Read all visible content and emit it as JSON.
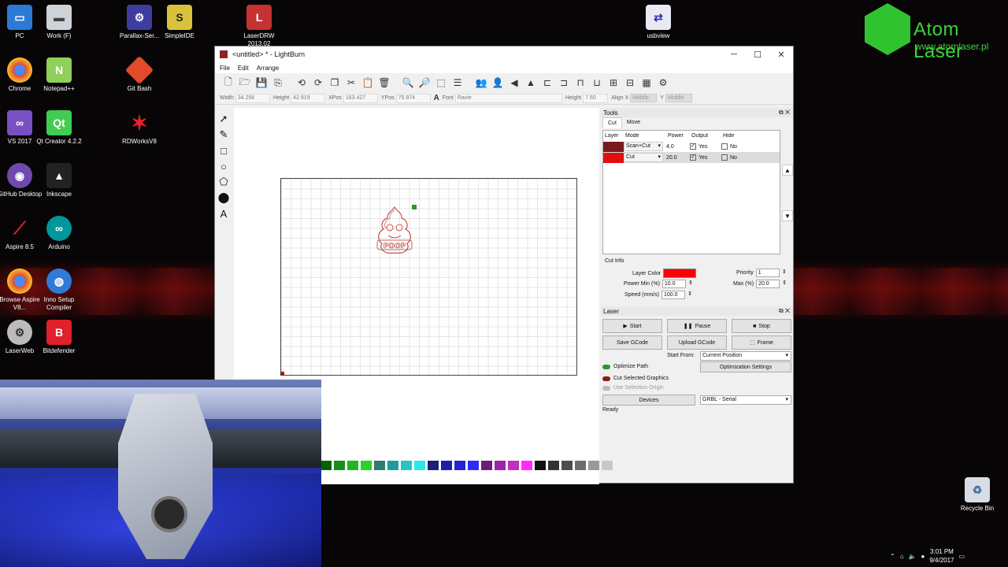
{
  "desktop": {
    "icons": [
      {
        "label": "PC"
      },
      {
        "label": "Work (F)"
      },
      {
        "label": "Parallax-Ser..."
      },
      {
        "label": "SimpleIDE"
      },
      {
        "label": "LaserDRW 2013.02"
      },
      {
        "label": "usbview"
      },
      {
        "label": "Chrome"
      },
      {
        "label": "Notepad++"
      },
      {
        "label": "Git Bash"
      },
      {
        "label": "VS 2017"
      },
      {
        "label": "Qt Creator 4.2.2"
      },
      {
        "label": "RDWorksV8"
      },
      {
        "label": "GitHub Desktop"
      },
      {
        "label": "Inkscape"
      },
      {
        "label": "Aspire 8.5"
      },
      {
        "label": "Arduino"
      },
      {
        "label": "Browse Aspire V8..."
      },
      {
        "label": "Inno Setup Compiler"
      },
      {
        "label": "LaserWeb"
      },
      {
        "label": "Bitdefender"
      },
      {
        "label": "Recycle Bin"
      }
    ],
    "logo": {
      "name": "Atom Laser",
      "url": "www.atomlaser.pl"
    },
    "tray": {
      "time": "3:01 PM",
      "date": "9/4/2017"
    }
  },
  "window": {
    "title": "<untitled> * - LightBurn",
    "menu": [
      "File",
      "Edit",
      "Arrange"
    ],
    "props": {
      "width_label": "Width",
      "width": "34.256",
      "height_label": "Height",
      "height": "42.919",
      "xpos_label": "XPos",
      "xpos": "163.427",
      "ypos_label": "YPos",
      "ypos": "75.974",
      "font_label": "Font",
      "font": "Ravie",
      "text_height_label": "Height",
      "text_height": "7.50",
      "alignx_label": "Align X",
      "alignx": "Middle",
      "aligny_label": "Y",
      "aligny": "Middle"
    },
    "canvas": {
      "drawing_text": "POOP"
    },
    "palette": [
      "#006400",
      "#1a8c1a",
      "#22b422",
      "#29d429",
      "#2e7d6e",
      "#1e9c9c",
      "#26c4c4",
      "#2ee8e8",
      "#1c1c7a",
      "#1e1eaa",
      "#2424d4",
      "#2a2aff",
      "#6e1e7a",
      "#9a26aa",
      "#c42ec4",
      "#ff2aff",
      "#111111",
      "#333333",
      "#4d4d4d",
      "#6e6e6e",
      "#999999",
      "#c8c8c8"
    ]
  },
  "tools_panel": {
    "title": "Tools",
    "tabs": [
      "Cut",
      "Move"
    ],
    "headers": {
      "layer": "Layer",
      "mode": "Mode",
      "power": "Power",
      "output": "Output",
      "hide": "Hide"
    },
    "rows": [
      {
        "color": "#7a1a1a",
        "mode": "Scan+Cut",
        "power": "4.0",
        "output": "Yes",
        "hide": "No"
      },
      {
        "color": "#e01010",
        "mode": "Cut",
        "power": "20.0",
        "output": "Yes",
        "hide": "No"
      }
    ],
    "cut_info": {
      "title": "Cut Info",
      "layer_color_label": "Layer Color",
      "layer_color": "#ff0000",
      "priority_label": "Priority",
      "priority": "1",
      "power_min_label": "Power Min (%)",
      "power_min": "10.0",
      "max_label": "Max (%)",
      "max": "20.0",
      "speed_label": "Speed  (mm/s)",
      "speed": "100.0"
    }
  },
  "laser_panel": {
    "title": "Laser",
    "start": "Start",
    "pause": "Pause",
    "stop": "Stop",
    "save_gcode": "Save GCode",
    "upload_gcode": "Upload GCode",
    "frame": "Frame",
    "start_from_label": "Start From:",
    "start_from": "Current Position",
    "optimize_path": "Optimize Path",
    "optimization_settings": "Optimization Settings",
    "cut_selected": "Cut Selected Graphics",
    "use_selection_origin": "Use Selection Origin",
    "devices": "Devices",
    "device": "GRBL - Serial",
    "status": "Ready"
  }
}
